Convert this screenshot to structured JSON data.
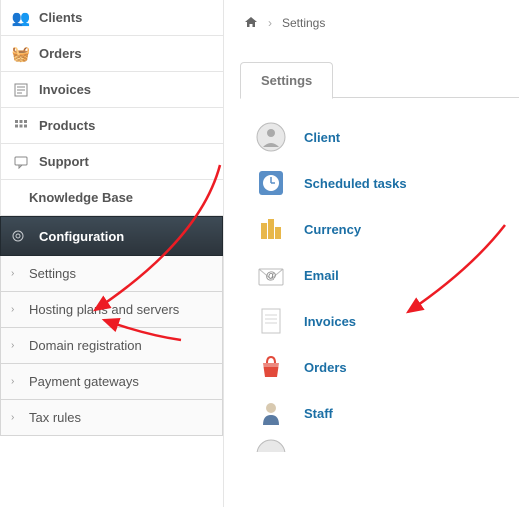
{
  "nav": {
    "clients": "Clients",
    "orders": "Orders",
    "invoices": "Invoices",
    "products": "Products",
    "support": "Support",
    "kb": "Knowledge Base"
  },
  "config": {
    "header": "Configuration",
    "settings": "Settings",
    "hosting": "Hosting plans and servers",
    "domain": "Domain registration",
    "gateways": "Payment gateways",
    "tax": "Tax rules"
  },
  "breadcrumb": {
    "current": "Settings"
  },
  "tab": {
    "settings": "Settings"
  },
  "settings_list": {
    "client": "Client",
    "scheduled": "Scheduled tasks",
    "currency": "Currency",
    "email": "Email",
    "invoices": "Invoices",
    "orders": "Orders",
    "staff": "Staff"
  }
}
